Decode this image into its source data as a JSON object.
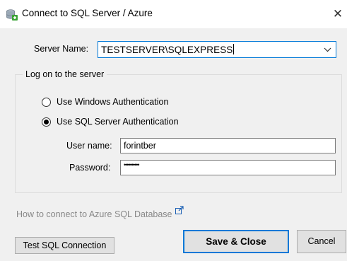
{
  "window": {
    "title": "Connect to SQL Server / Azure",
    "close_label": "✕",
    "icon": "database-connect-icon"
  },
  "server": {
    "label": "Server Name:",
    "value": "TESTSERVER\\SQLEXPRESS"
  },
  "logon": {
    "group_label": "Log on to the server",
    "options": [
      {
        "label": "Use Windows Authentication",
        "selected": false
      },
      {
        "label": "Use SQL Server Authentication",
        "selected": true
      }
    ],
    "username_label": "User name:",
    "username_value": "forintber",
    "password_label": "Password:",
    "password_mask": "••••••••••"
  },
  "azure_link": {
    "text": "How to connect to Azure SQL Database",
    "icon": "external-link-icon"
  },
  "buttons": {
    "test": "Test SQL Connection",
    "save": "Save & Close",
    "cancel": "Cancel"
  },
  "colors": {
    "focus_blue": "#0078d7",
    "link_gray": "#888888",
    "background": "#f0f0f0"
  }
}
